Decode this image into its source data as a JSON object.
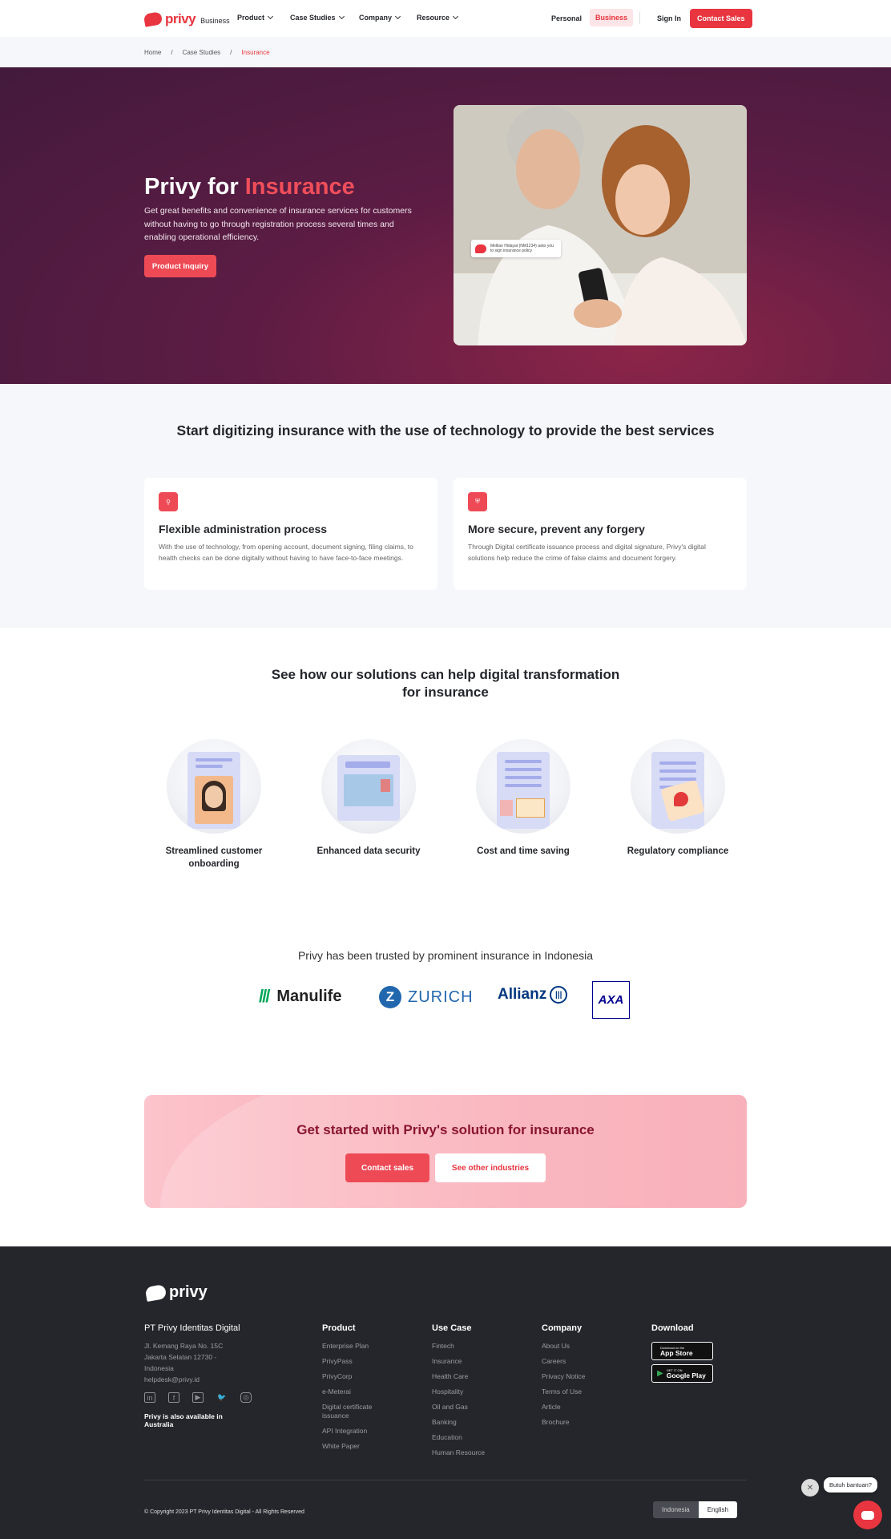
{
  "nav": {
    "brand": "privy",
    "brand_sub": "Business",
    "menu": [
      "Product",
      "Case Studies",
      "Company",
      "Resource"
    ],
    "personal": "Personal",
    "business": "Business",
    "sign_in": "Sign In",
    "contact_sales": "Contact Sales"
  },
  "breadcrumb": [
    "Home",
    "Case Studies",
    "Insurance"
  ],
  "hero": {
    "title_plain": "Privy for ",
    "title_highlight": "Insurance",
    "description": "Get great benefits and convenience of insurance services for customers without having to go through registration process several times and enabling operational efficiency.",
    "button": "Product Inquiry",
    "notification": "Melliao Hidayat (NM1234) asks you to sign insurance policy"
  },
  "digitize": {
    "heading": "Start digitizing insurance with the use of technology to provide the best services",
    "cards": [
      {
        "title": "Flexible administration process",
        "text": "With the use of technology, from opening account, document signing, filing claims, to health checks can be done digitally without having to have face-to-face meetings."
      },
      {
        "title": "More secure, prevent any forgery",
        "text": "Through Digital certificate issuance process and digital signature, Privy's digital solutions help reduce the crime of false claims and document forgery."
      }
    ]
  },
  "solutions": {
    "heading": "See how our solutions can help digital transformation for insurance",
    "items": [
      "Streamlined customer onboarding",
      "Enhanced data security",
      "Cost and time saving",
      "Regulatory compliance"
    ]
  },
  "trusted": {
    "heading": "Privy has been trusted by prominent insurance in Indonesia",
    "brands": [
      "Manulife",
      "ZURICH",
      "Allianz",
      "AXA"
    ]
  },
  "cta": {
    "heading": "Get started with Privy's solution for insurance",
    "contact": "Contact sales",
    "other": "See other industries"
  },
  "footer": {
    "brand": "privy",
    "company": "PT Privy Identitas Digital",
    "address": "Jl. Kemang Raya No. 15C Jakarta Selatan 12730 - Indonesia",
    "email": "helpdesk@privy.id",
    "available": "Privy is also available in Australia",
    "columns": [
      {
        "title": "Product",
        "items": [
          "Enterprise Plan",
          "PrivyPass",
          "PrivyCorp",
          "e-Meterai",
          "Digital certificate issuance",
          "API Integration",
          "White Paper"
        ]
      },
      {
        "title": "Use Case",
        "items": [
          "Fintech",
          "Insurance",
          "Health Care",
          "Hospitality",
          "Oil and Gas",
          "Banking",
          "Education",
          "Human Resource"
        ]
      },
      {
        "title": "Company",
        "items": [
          "About Us",
          "Careers",
          "Privacy Notice",
          "Terms of Use",
          "Article",
          "Brochure"
        ]
      }
    ],
    "download_title": "Download",
    "app_store_small": "Download on the",
    "app_store": "App Store",
    "google_play_small": "GET IT ON",
    "google_play": "Google Play",
    "copyright": "© Copyright 2023 PT Privy Identitas Digital - All Rights Reserved",
    "lang_id": "Indonesia",
    "lang_en": "English"
  },
  "chat": {
    "bubble": "Butuh bantuan?"
  },
  "colors": {
    "accent": "#e8353f",
    "hero_bg": "#4a1b40",
    "footer_bg": "#24262b"
  }
}
